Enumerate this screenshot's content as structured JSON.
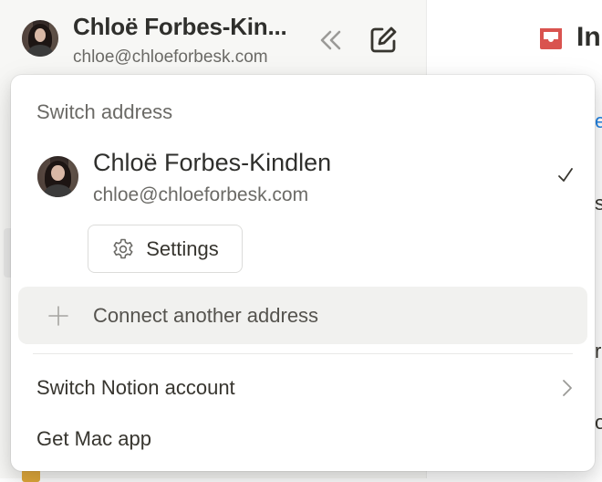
{
  "header": {
    "name": "Chloë Forbes-Kin...",
    "email": "chloe@chloeforbesk.com"
  },
  "main": {
    "title": "In",
    "peek_chars": [
      "e",
      "s",
      "r",
      "or"
    ]
  },
  "menu": {
    "section_title": "Switch address",
    "account": {
      "name": "Chloë Forbes-Kindlen",
      "email": "chloe@chloeforbesk.com",
      "selected": true
    },
    "settings_label": "Settings",
    "connect_label": "Connect another address",
    "switch_account_label": "Switch Notion account",
    "get_app_label": "Get Mac app"
  },
  "colors": {
    "inbox_icon": "#d9534f",
    "sidebar_bg": "#f7f7f5",
    "hover_row": "#f1f1ef",
    "accent_peek": "#2383e2"
  },
  "icons": [
    "collapse-sidebar-icon",
    "compose-icon",
    "inbox-icon",
    "check-icon",
    "gear-icon",
    "plus-icon",
    "chevron-right-icon"
  ]
}
